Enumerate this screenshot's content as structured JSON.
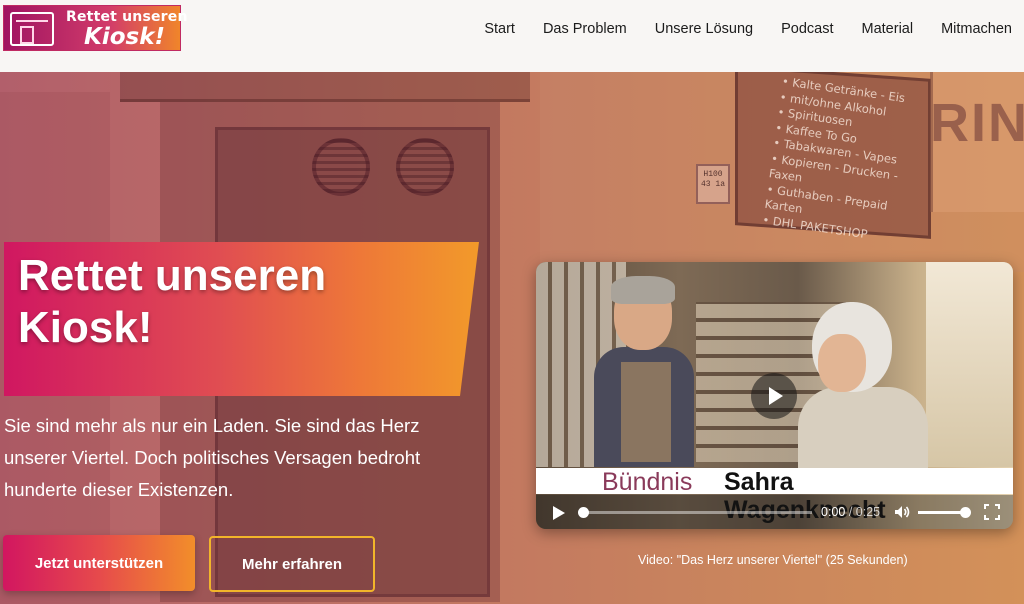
{
  "header": {
    "logo": {
      "line1": "Rettet unseren",
      "line2": "Kiosk!"
    },
    "nav": [
      "Start",
      "Das Problem",
      "Unsere Lösung",
      "Podcast",
      "Material",
      "Mitmachen"
    ]
  },
  "hero": {
    "background_sign": {
      "items": [
        "Kalte Getränke - Eis",
        "mit/ohne Alkohol",
        "Spirituosen",
        "Kaffee To Go",
        "Tabakwaren - Vapes",
        "Kopieren - Drucken - Faxen",
        "Guthaben - Prepaid Karten",
        "DHL PAKETSHOP"
      ],
      "plate": "H100 43 1a",
      "letters": "RIN"
    },
    "headline": "Rettet unseren Kiosk!",
    "intro": "Sie sind mehr als nur ein Laden. Sie sind das Herz unserer Viertel. Doch politisches Versagen bedroht hunderte dieser Existenzen.",
    "primary_button": "Jetzt unterstützen",
    "secondary_button": "Mehr erfahren"
  },
  "video": {
    "lower_third_a": "Bündnis",
    "lower_third_b": "Sahra",
    "lower_third_c": "Wagenknecht",
    "current_time": "0:00",
    "separator": "/",
    "duration": "0:25",
    "progress": 0.0,
    "volume": 0.9,
    "caption": "Video: \"Das Herz unserer Viertel\" (25 Sekunden)"
  },
  "colors": {
    "accent_pink": "#d01761",
    "accent_orange": "#f29a2a",
    "outline_yellow": "#f2b52a"
  }
}
